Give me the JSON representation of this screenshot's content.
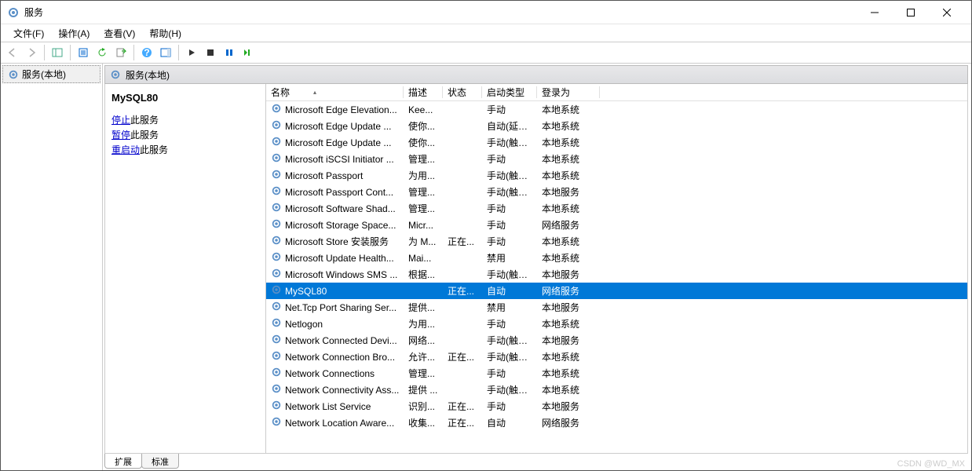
{
  "window": {
    "title": "服务"
  },
  "menu": {
    "file": "文件(F)",
    "action": "操作(A)",
    "view": "查看(V)",
    "help": "帮助(H)"
  },
  "tree": {
    "root": "服务(本地)"
  },
  "content_header": "服务(本地)",
  "detail": {
    "selected_name": "MySQL80",
    "stop_link": "停止",
    "stop_suffix": "此服务",
    "pause_link": "暂停",
    "pause_suffix": "此服务",
    "restart_link": "重启动",
    "restart_suffix": "此服务"
  },
  "columns": {
    "name": "名称",
    "desc": "描述",
    "status": "状态",
    "startup": "启动类型",
    "logon": "登录为"
  },
  "rows": [
    {
      "name": "Microsoft Edge Elevation...",
      "desc": "Kee...",
      "status": "",
      "startup": "手动",
      "logon": "本地系统",
      "selected": false
    },
    {
      "name": "Microsoft Edge Update ...",
      "desc": "使你...",
      "status": "",
      "startup": "自动(延迟...",
      "logon": "本地系统",
      "selected": false
    },
    {
      "name": "Microsoft Edge Update ...",
      "desc": "使你...",
      "status": "",
      "startup": "手动(触发...",
      "logon": "本地系统",
      "selected": false
    },
    {
      "name": "Microsoft iSCSI Initiator ...",
      "desc": "管理...",
      "status": "",
      "startup": "手动",
      "logon": "本地系统",
      "selected": false
    },
    {
      "name": "Microsoft Passport",
      "desc": "为用...",
      "status": "",
      "startup": "手动(触发...",
      "logon": "本地系统",
      "selected": false
    },
    {
      "name": "Microsoft Passport Cont...",
      "desc": "管理...",
      "status": "",
      "startup": "手动(触发...",
      "logon": "本地服务",
      "selected": false
    },
    {
      "name": "Microsoft Software Shad...",
      "desc": "管理...",
      "status": "",
      "startup": "手动",
      "logon": "本地系统",
      "selected": false
    },
    {
      "name": "Microsoft Storage Space...",
      "desc": "Micr...",
      "status": "",
      "startup": "手动",
      "logon": "网络服务",
      "selected": false
    },
    {
      "name": "Microsoft Store 安装服务",
      "desc": "为 M...",
      "status": "正在...",
      "startup": "手动",
      "logon": "本地系统",
      "selected": false
    },
    {
      "name": "Microsoft Update Health...",
      "desc": "Mai...",
      "status": "",
      "startup": "禁用",
      "logon": "本地系统",
      "selected": false
    },
    {
      "name": "Microsoft Windows SMS ...",
      "desc": "根据...",
      "status": "",
      "startup": "手动(触发...",
      "logon": "本地服务",
      "selected": false
    },
    {
      "name": "MySQL80",
      "desc": "",
      "status": "正在...",
      "startup": "自动",
      "logon": "网络服务",
      "selected": true
    },
    {
      "name": "Net.Tcp Port Sharing Ser...",
      "desc": "提供...",
      "status": "",
      "startup": "禁用",
      "logon": "本地服务",
      "selected": false
    },
    {
      "name": "Netlogon",
      "desc": "为用...",
      "status": "",
      "startup": "手动",
      "logon": "本地系统",
      "selected": false
    },
    {
      "name": "Network Connected Devi...",
      "desc": "网络...",
      "status": "",
      "startup": "手动(触发...",
      "logon": "本地服务",
      "selected": false
    },
    {
      "name": "Network Connection Bro...",
      "desc": "允许...",
      "status": "正在...",
      "startup": "手动(触发...",
      "logon": "本地系统",
      "selected": false
    },
    {
      "name": "Network Connections",
      "desc": "管理...",
      "status": "",
      "startup": "手动",
      "logon": "本地系统",
      "selected": false
    },
    {
      "name": "Network Connectivity Ass...",
      "desc": "提供 ...",
      "status": "",
      "startup": "手动(触发...",
      "logon": "本地系统",
      "selected": false
    },
    {
      "name": "Network List Service",
      "desc": "识别...",
      "status": "正在...",
      "startup": "手动",
      "logon": "本地服务",
      "selected": false
    },
    {
      "name": "Network Location Aware...",
      "desc": "收集...",
      "status": "正在...",
      "startup": "自动",
      "logon": "网络服务",
      "selected": false
    }
  ],
  "tabs": {
    "extended": "扩展",
    "standard": "标准"
  },
  "watermark": "CSDN @WD_MX"
}
